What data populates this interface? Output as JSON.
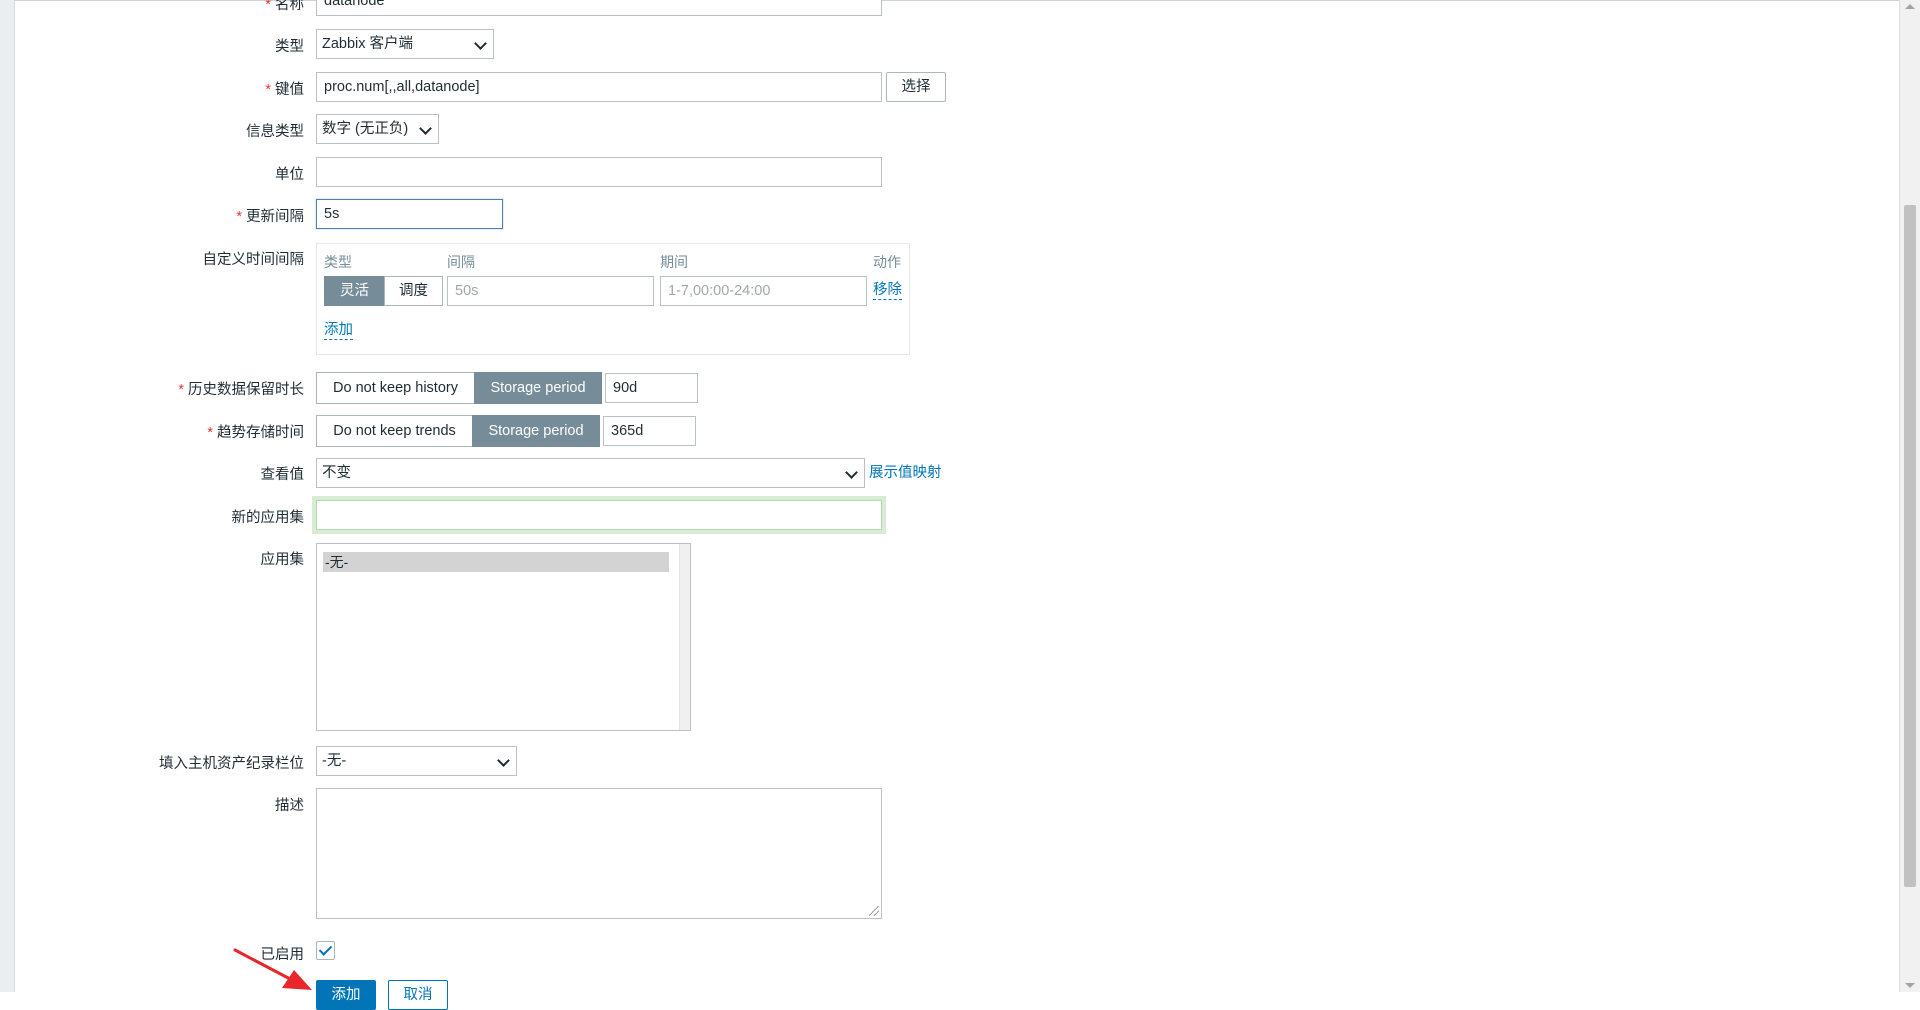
{
  "form": {
    "name": {
      "label": "名称",
      "value": "datanode"
    },
    "type": {
      "label": "类型",
      "value": "Zabbix 客户端"
    },
    "key": {
      "label": "键值",
      "value": "proc.num[,,all,datanode]",
      "select_label": "选择"
    },
    "info_type": {
      "label": "信息类型",
      "value": "数字 (无正负)"
    },
    "units": {
      "label": "单位",
      "value": ""
    },
    "update_interval": {
      "label": "更新间隔",
      "value": "5s"
    },
    "custom_intervals": {
      "label": "自定义时间间隔",
      "headers": {
        "type": "类型",
        "interval": "间隔",
        "period": "期间",
        "action": "动作"
      },
      "row": {
        "flexible": "灵活",
        "scheduling": "调度",
        "interval_placeholder": "50s",
        "period_placeholder": "1-7,00:00-24:00",
        "remove": "移除"
      },
      "add": "添加"
    },
    "history": {
      "label": "历史数据保留时长",
      "option_no_keep": "Do not keep history",
      "option_storage": "Storage period",
      "value": "90d"
    },
    "trends": {
      "label": "趋势存储时间",
      "option_no_keep": "Do not keep trends",
      "option_storage": "Storage period",
      "value": "365d"
    },
    "show_value": {
      "label": "查看值",
      "value": "不变",
      "mapping_link": "展示值映射"
    },
    "new_application": {
      "label": "新的应用集",
      "value": ""
    },
    "applications": {
      "label": "应用集",
      "options": [
        "-无-"
      ]
    },
    "inventory_field": {
      "label": "填入主机资产纪录栏位",
      "value": "-无-"
    },
    "description": {
      "label": "描述",
      "value": ""
    },
    "enabled": {
      "label": "已启用",
      "checked": true
    },
    "buttons": {
      "add": "添加",
      "cancel": "取消"
    }
  },
  "colors": {
    "accent": "#0275b8",
    "required": "#e33734",
    "segment_active": "#768d99",
    "annotation_arrow": "#e8262b"
  }
}
